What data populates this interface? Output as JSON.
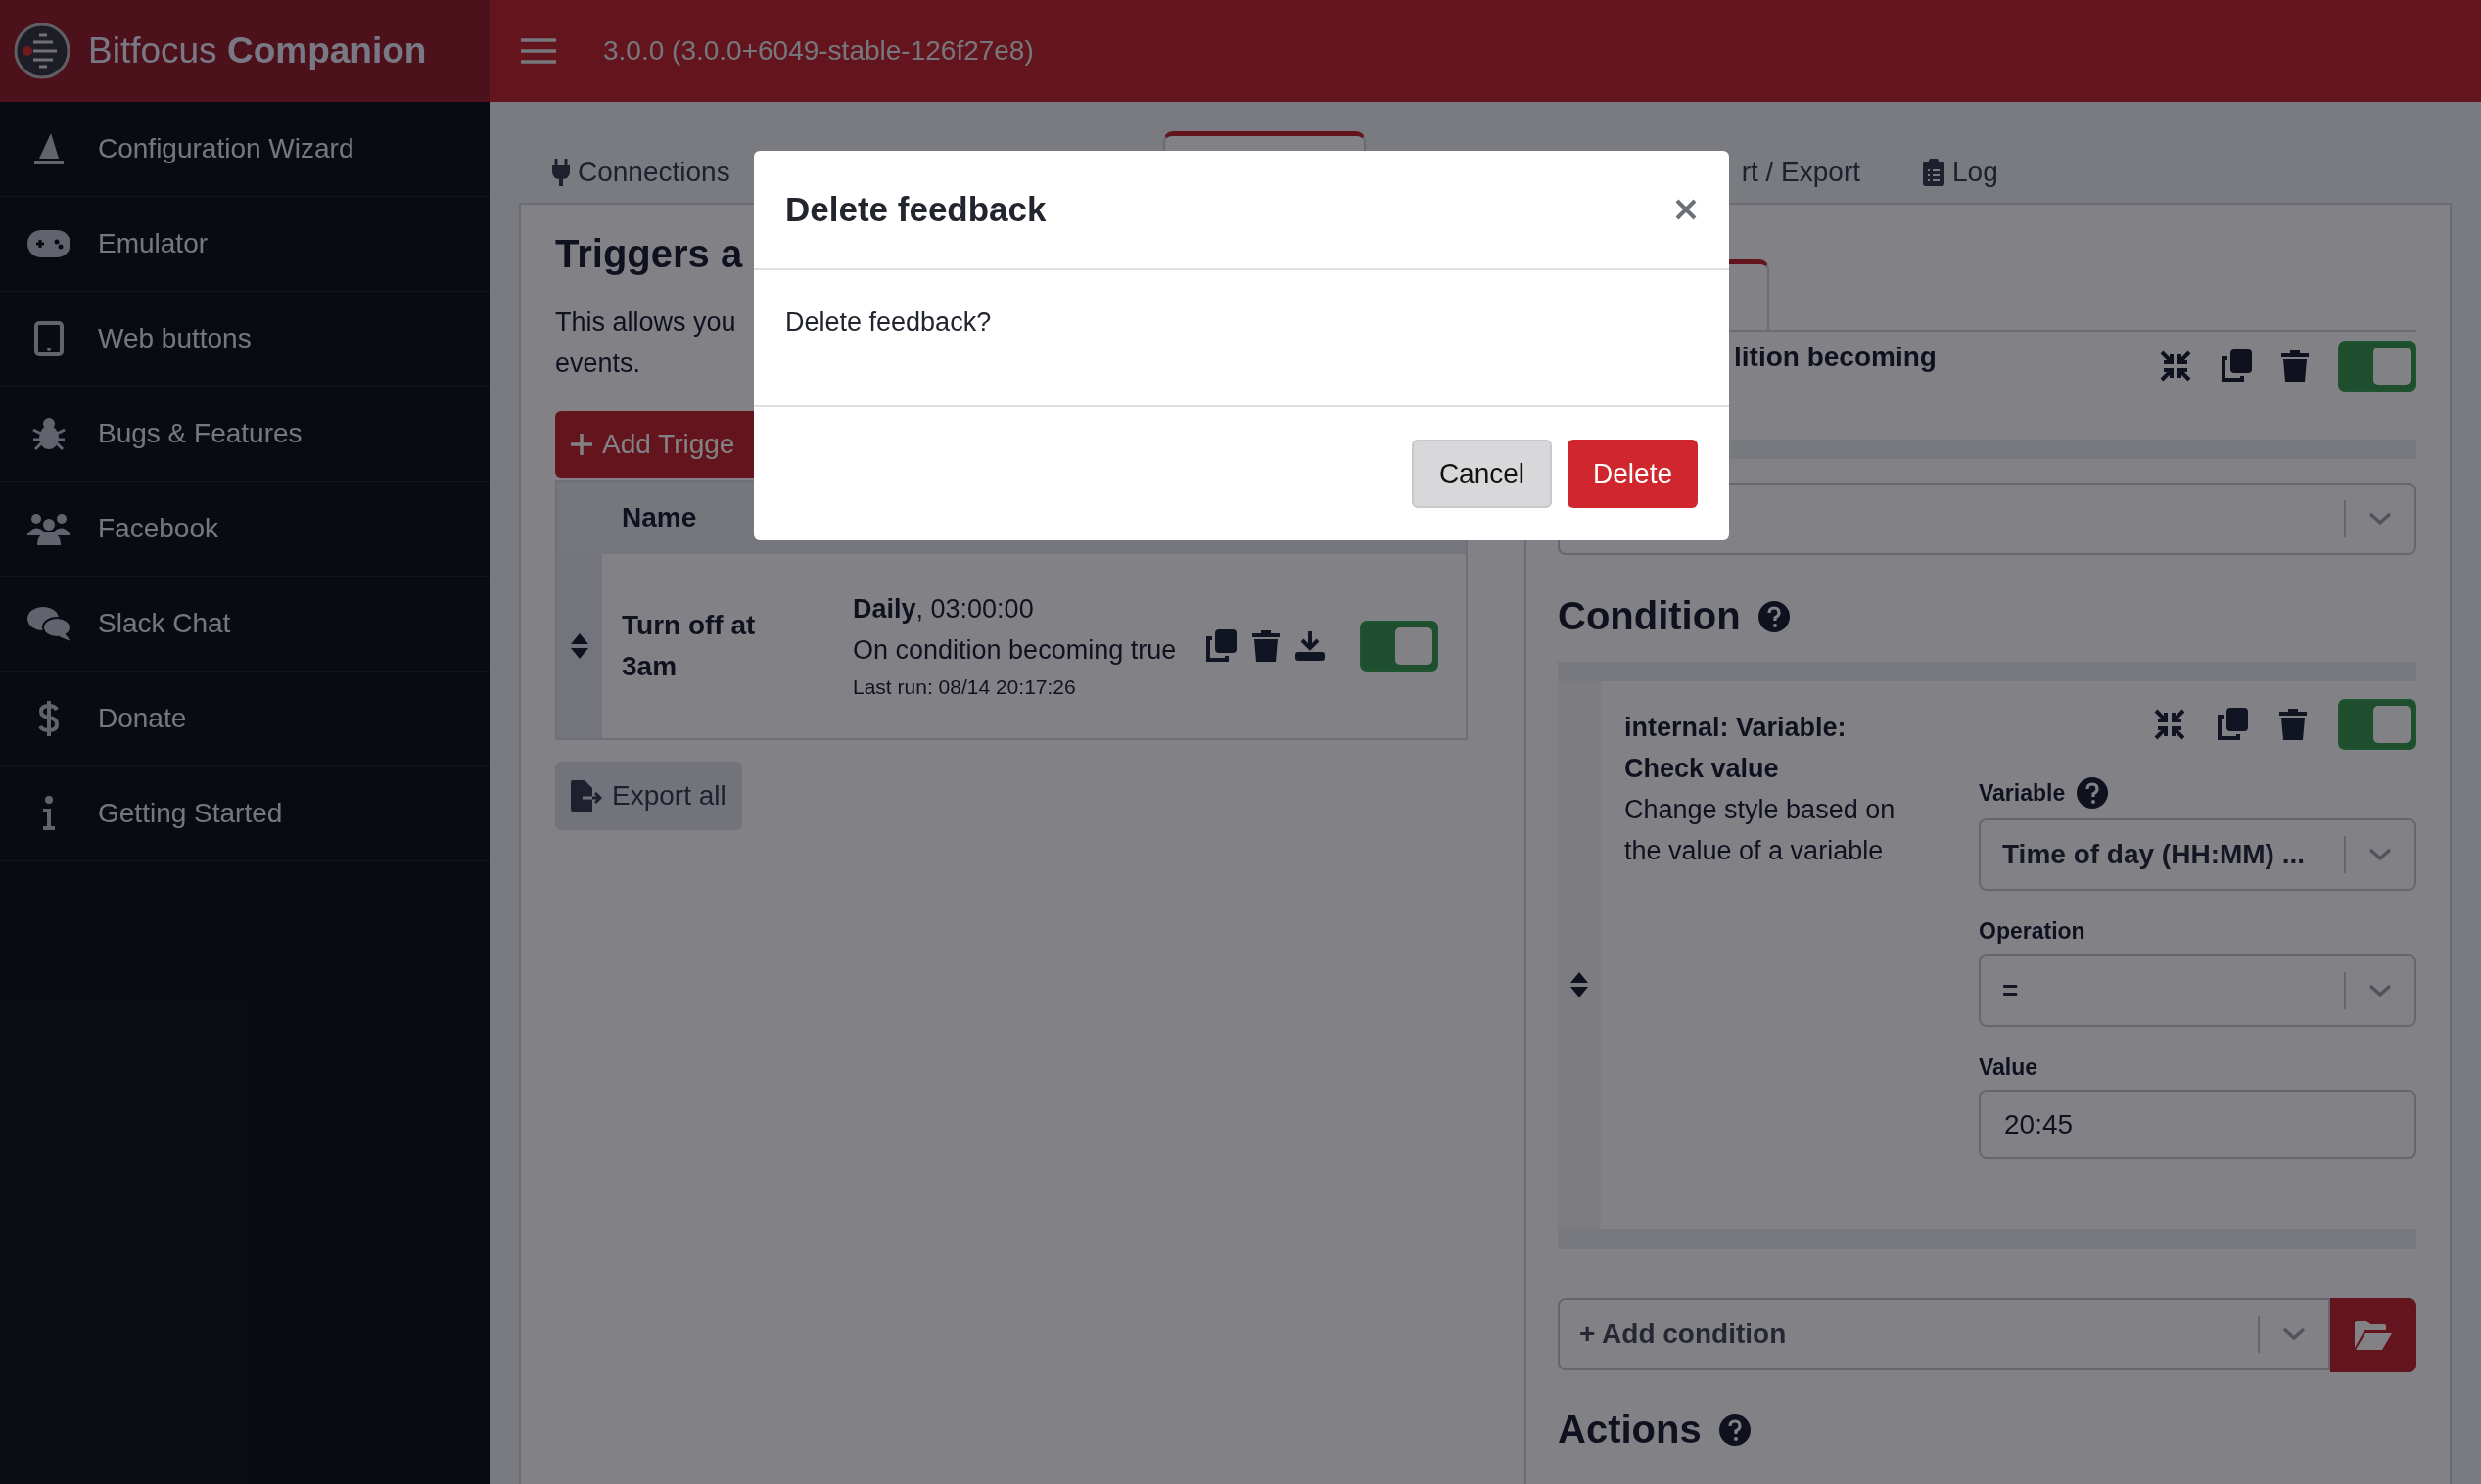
{
  "header": {
    "brand": "Bitfocus **Companion**",
    "version": "3.0.0 (3.0.0+6049-stable-126f27e8)"
  },
  "sidebar": {
    "items": [
      {
        "label": "Configuration Wizard"
      },
      {
        "label": "Emulator"
      },
      {
        "label": "Web buttons"
      },
      {
        "label": "Bugs & Features"
      },
      {
        "label": "Facebook"
      },
      {
        "label": "Slack Chat"
      },
      {
        "label": "Donate"
      },
      {
        "label": "Getting Started"
      }
    ]
  },
  "tabs": [
    {
      "label": "Connections",
      "selected": false
    },
    {
      "selected": true
    },
    {
      "label": "rt / Export",
      "selected": false
    },
    {
      "label": "Log",
      "selected": false
    }
  ],
  "triggers_panel": {
    "title": "Triggers a",
    "description_lines": [
      "This allows you",
      "events."
    ],
    "add_button": "Add Trigge",
    "columns": [
      "Name"
    ],
    "rows": [
      {
        "name": "Turn off at 3am",
        "schedule": "**Daily**, 03:00:00",
        "condition": "On condition becoming true",
        "last_run": "Last run: 08/14 20:17:26",
        "enabled": true
      }
    ],
    "export_button": "Export all"
  },
  "editor": {
    "tab_selected": true,
    "summary": "lition becoming",
    "enabled": true,
    "condition_heading": "Condition",
    "condition": {
      "title": "internal: Variable: Check value",
      "description": "Change style based on the value of a variable",
      "enabled": true,
      "fields": [
        {
          "label": "Variable",
          "help": true,
          "kind": "select",
          "value": "Time of day (HH:MM) ..."
        },
        {
          "label": "Operation",
          "help": false,
          "kind": "select",
          "value": "="
        },
        {
          "label": "Value",
          "help": false,
          "kind": "text",
          "value": "20:45"
        }
      ]
    },
    "add_condition": "+ Add condition",
    "actions_heading": "Actions"
  },
  "modal": {
    "title": "Delete feedback",
    "message": "Delete feedback?",
    "buttons": [
      {
        "label": "Cancel",
        "kind": "secondary"
      },
      {
        "label": "Delete",
        "kind": "danger"
      }
    ]
  }
}
